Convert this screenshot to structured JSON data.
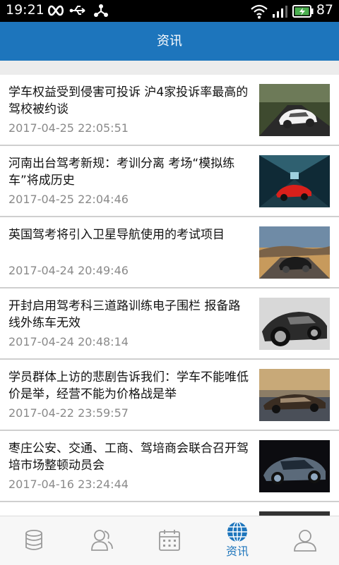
{
  "status": {
    "time": "19:21",
    "battery": "87"
  },
  "header": {
    "title": "资讯"
  },
  "news": [
    {
      "title": "学车权益受到侵害可投诉 沪4家投诉率最高的驾校被约谈",
      "date": "2017-04-25 22:05:51",
      "thumb_icon": "white-sports-car-image"
    },
    {
      "title": "河南出台驾考新规：考训分离 考场“模拟练车”将成历史",
      "date": "2017-04-25 22:04:46",
      "thumb_icon": "red-car-tunnel-image"
    },
    {
      "title": "英国驾考将引入卫星导航使用的考试项目",
      "date": "2017-04-24 20:49:46",
      "thumb_icon": "car-on-road-image"
    },
    {
      "title": "开封启用驾考科三道路训练电子围栏 报备路线外练车无效",
      "date": "2017-04-24 20:48:14",
      "thumb_icon": "black-white-car-image"
    },
    {
      "title": "学员群体上访的悲剧告诉我们：学车不能唯低价是举，经营不能为价格战是举",
      "date": "2017-04-22 23:59:57",
      "thumb_icon": "sedan-sunset-image"
    },
    {
      "title": "枣庄公安、交通、工商、驾培商会联合召开驾培市场整顿动员会",
      "date": "2017-04-16 23:24:44",
      "thumb_icon": "concept-car-image"
    }
  ],
  "tabs": [
    {
      "name": "database-icon",
      "label": ""
    },
    {
      "name": "users-icon",
      "label": ""
    },
    {
      "name": "calendar-icon",
      "label": ""
    },
    {
      "name": "globe-icon",
      "label": "资讯",
      "active": true
    },
    {
      "name": "profile-icon",
      "label": ""
    }
  ],
  "colors": {
    "primary": "#1d75bc",
    "status_bar": "#000000",
    "battery": "#4caf50"
  }
}
